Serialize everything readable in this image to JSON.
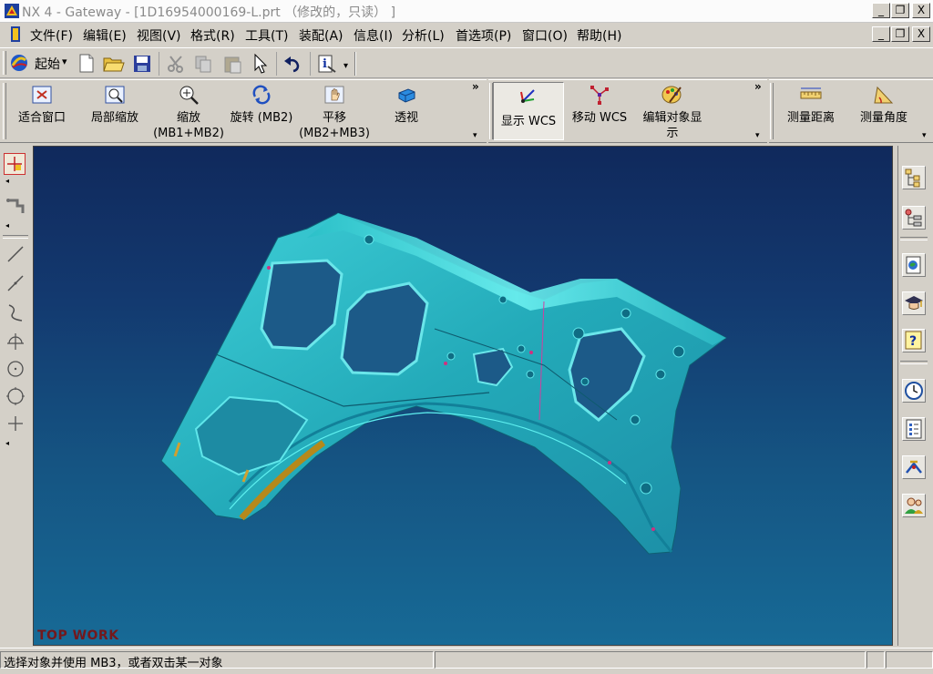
{
  "window": {
    "title": "NX 4 - Gateway - [1D16954000169-L.prt （修改的，只读） ]",
    "controls": [
      "_",
      "❐",
      "X"
    ]
  },
  "menubar": {
    "items": [
      "文件(F)",
      "编辑(E)",
      "视图(V)",
      "格式(R)",
      "工具(T)",
      "装配(A)",
      "信息(I)",
      "分析(L)",
      "首选项(P)",
      "窗口(O)",
      "帮助(H)"
    ]
  },
  "standard_toolbar": {
    "start_label": "起始",
    "dropdown_arrow": "▾",
    "icons": [
      "start-icon",
      "new-file-icon",
      "open-folder-icon",
      "save-icon",
      "cut-icon",
      "copy-icon",
      "paste-icon",
      "select-pointer-icon",
      "undo-icon",
      "info-icon"
    ]
  },
  "view_toolbar": {
    "buttons": [
      {
        "icon": "fit-window-icon",
        "line1": "适合窗口",
        "line2": ""
      },
      {
        "icon": "zoom-region-icon",
        "line1": "局部缩放",
        "line2": ""
      },
      {
        "icon": "zoom-icon",
        "line1": "缩放",
        "line2": "(MB1+MB2)"
      },
      {
        "icon": "rotate-icon",
        "line1": "旋转 (MB2)",
        "line2": ""
      },
      {
        "icon": "pan-icon",
        "line1": "平移",
        "line2": "(MB2+MB3)"
      },
      {
        "icon": "perspective-icon",
        "line1": "透视",
        "line2": ""
      }
    ],
    "overflow": "»"
  },
  "wcs_toolbar": {
    "buttons": [
      {
        "icon": "display-wcs-icon",
        "line1": "显示 WCS",
        "line2": "",
        "active": true
      },
      {
        "icon": "move-wcs-icon",
        "line1": "移动 WCS",
        "line2": "",
        "active": false
      },
      {
        "icon": "edit-object-display-icon",
        "line1": "编辑对象显",
        "line2": "示",
        "active": false
      }
    ],
    "overflow": "»"
  },
  "measure_toolbar": {
    "buttons": [
      {
        "icon": "measure-distance-icon",
        "line1": "测量距离"
      },
      {
        "icon": "measure-angle-icon",
        "line1": "测量角度"
      }
    ]
  },
  "left_toolbar": {
    "icons": [
      "snap-point-icon",
      "selection-filter-icon",
      "line-icon",
      "line-icon",
      "arc-icon",
      "crosshair-icon",
      "circle-icon",
      "circle-icon",
      "point-icon"
    ]
  },
  "right_toolbar": {
    "icons": [
      "assembly-navigator-icon",
      "part-navigator-icon",
      "web-browser-icon",
      "training-icon",
      "help-icon",
      "history-icon",
      "palette-icon",
      "roles-icon",
      "user-roles-icon"
    ]
  },
  "viewport": {
    "watermark": "TOP WORK",
    "colors": {
      "part": "#2ab7c3",
      "part_light": "#56e4ea",
      "part_dark": "#1a7f93",
      "edge_highlight": "#b5891b",
      "background_top": "#10295c",
      "background_bottom": "#176a96"
    }
  },
  "statusbar": {
    "message": "选择对象并使用 MB3，或者双击某一对象",
    "panel2": "",
    "panel3": ""
  }
}
